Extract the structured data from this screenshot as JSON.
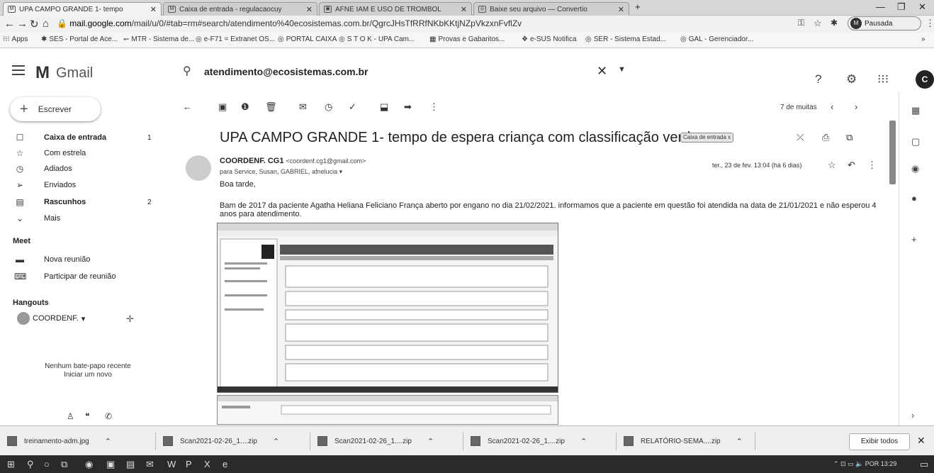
{
  "browser": {
    "tabs": [
      {
        "icon": "M",
        "title": "UPA CAMPO GRANDE 1- tempo"
      },
      {
        "icon": "M",
        "title": "Caixa de entrada - regulacaocuy"
      },
      {
        "icon": "▣",
        "title": "AFNE IAM E USO DE TROMBOL"
      },
      {
        "icon": "◎",
        "title": "Baixe seu arquivo — Convertio"
      }
    ],
    "url_host": "mail.google.com",
    "url_path": "/mail/u/0/#tab=rm#search/atendimento%40ecosistemas.com.br/QgrcJHsTfRRfNKbKKtjNZpVkzxnFvflZv",
    "profile_label": "Pausada",
    "profile_initial": "M"
  },
  "bookmarks": [
    "Apps",
    "SES - Portal de Ace...",
    "MTR - Sistema de...",
    "e-F71 = Extranet OS...",
    "PORTAL CAIXA",
    "S T O K - UPA Cam...",
    "Provas e Gabaritos...",
    "e-SUS Notifica",
    "SER - Sistema Estad...",
    "GAL - Gerenciador..."
  ],
  "gmail": {
    "logo_text": "Gmail",
    "search_value": "atendimento@ecosistemas.com.br",
    "avatar_initial": "C",
    "compose_label": "Escrever",
    "nav": [
      {
        "icon": "inbox-icon",
        "glyph": "☐",
        "label": "Caixa de entrada",
        "count": "1",
        "bold": true
      },
      {
        "icon": "star-icon",
        "glyph": "☆",
        "label": "Com estrela",
        "count": "",
        "bold": false
      },
      {
        "icon": "snooze-icon",
        "glyph": "◷",
        "label": "Adiados",
        "count": "",
        "bold": false
      },
      {
        "icon": "send-icon",
        "glyph": "➢",
        "label": "Enviados",
        "count": "",
        "bold": false
      },
      {
        "icon": "draft-icon",
        "glyph": "▤",
        "label": "Rascunhos",
        "count": "2",
        "bold": true
      },
      {
        "icon": "chevron-down-icon",
        "glyph": "⌄",
        "label": "Mais",
        "count": "",
        "bold": false
      }
    ],
    "meet_title": "Meet",
    "meet_items": [
      {
        "icon": "video-icon",
        "glyph": "▬",
        "label": "Nova reunião"
      },
      {
        "icon": "keyboard-icon",
        "glyph": "⌨",
        "label": "Participar de reunião"
      }
    ],
    "hangouts_title": "Hangouts",
    "hangouts_user": "COORDENF.",
    "no_chats_line1": "Nenhum bate-papo recente",
    "no_chats_line2": "Iniciar um novo"
  },
  "message": {
    "pager_text": "7 de muitas",
    "subject": "UPA CAMPO GRANDE 1- tempo de espera criança com classificação verde",
    "label_chip": "Caixa de entrada x",
    "sender_name": "COORDENF. CG1",
    "sender_email": "<coordenf.cg1@gmail.com>",
    "recipients": "para Service, Susan, GABRIEL, afnelucia",
    "date": "ter., 23 de fev. 13:04 (há 6 dias)",
    "greeting": "Boa tarde,",
    "body": "Bam de 2017 da paciente Agatha Heliana Feliciano França aberto por engano no dia 21/02/2021. informamos que a paciente em questão foi atendida na data de 21/01/2021 e não esperou 4 anos para atendimento."
  },
  "downloads": [
    {
      "name": "treinamento-adm.jpg"
    },
    {
      "name": "Scan2021-02-26_1....zip"
    },
    {
      "name": "Scan2021-02-26_1....zip"
    },
    {
      "name": "Scan2021-02-26_1....zip"
    },
    {
      "name": "RELATÓRIO-SEMA....zip"
    }
  ],
  "downloads_show_all": "Exibir todos",
  "taskbar": {
    "tray_text": "POR 13:29"
  }
}
